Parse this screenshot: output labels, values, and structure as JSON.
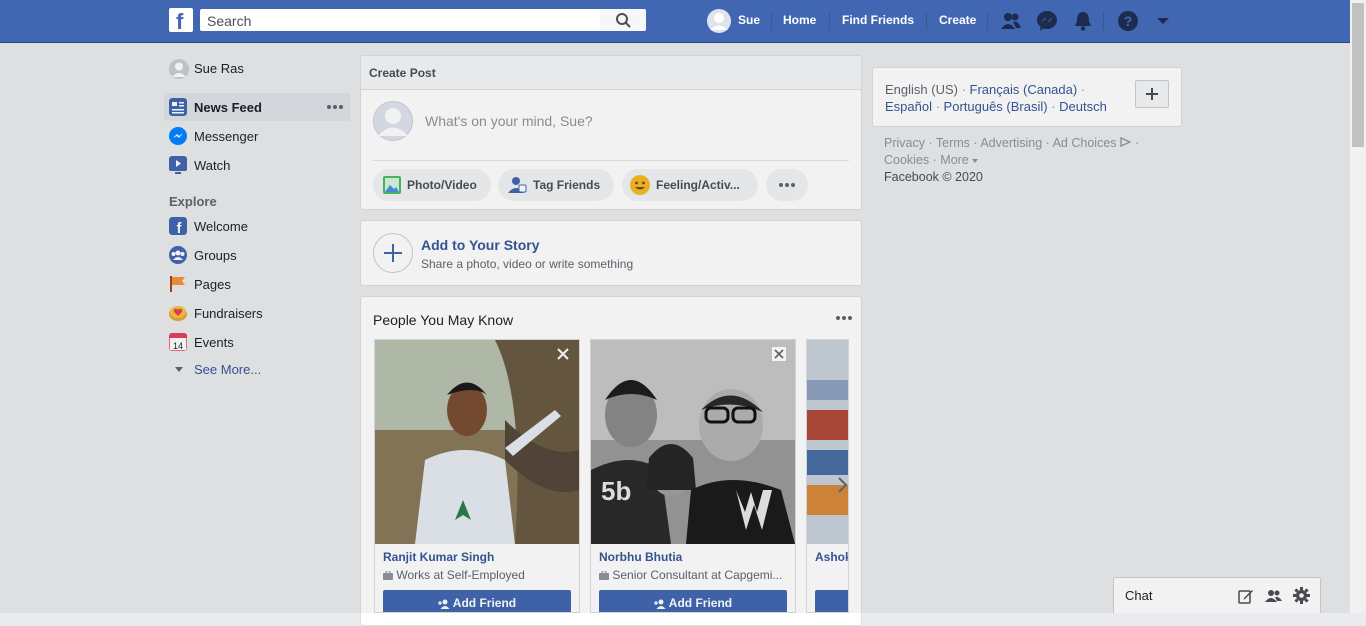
{
  "header": {
    "search_placeholder": "Search",
    "profile_name": "Sue",
    "nav": [
      "Home",
      "Find Friends",
      "Create"
    ]
  },
  "sidebar": {
    "user_name": "Sue Ras",
    "items": [
      {
        "label": "News Feed",
        "icon": "news-feed-icon"
      },
      {
        "label": "Messenger",
        "icon": "messenger-icon"
      },
      {
        "label": "Watch",
        "icon": "watch-icon"
      }
    ],
    "explore_title": "Explore",
    "explore": [
      {
        "label": "Welcome",
        "icon": "facebook-icon"
      },
      {
        "label": "Groups",
        "icon": "groups-icon"
      },
      {
        "label": "Pages",
        "icon": "flag-icon"
      },
      {
        "label": "Fundraisers",
        "icon": "fundraiser-icon"
      },
      {
        "label": "Events",
        "icon": "calendar-icon"
      }
    ],
    "see_more": "See More...",
    "calendar_day": "14"
  },
  "composer": {
    "title": "Create Post",
    "placeholder": "What's on your mind, Sue?",
    "actions": [
      "Photo/Video",
      "Tag Friends",
      "Feeling/Activ..."
    ]
  },
  "story": {
    "title": "Add to Your Story",
    "subtitle": "Share a photo, video or write something"
  },
  "pymk": {
    "title": "People You May Know",
    "people": [
      {
        "name": "Ranjit Kumar Singh",
        "work": "Works at Self-Employed",
        "button": "Add Friend"
      },
      {
        "name": "Norbhu Bhutia",
        "work": "Senior Consultant at Capgemi...",
        "button": "Add Friend"
      },
      {
        "name": "Ashok",
        "work": "",
        "button": ""
      }
    ]
  },
  "right": {
    "lang_current": "English (US)",
    "langs": [
      "Français (Canada)",
      "Español",
      "Português (Brasil)",
      "Deutsch"
    ],
    "footer_links": [
      "Privacy",
      "Terms",
      "Advertising",
      "Ad Choices",
      "Cookies",
      "More"
    ],
    "copyright": "Facebook © 2020"
  },
  "chat": {
    "label": "Chat"
  },
  "colors": {
    "brand": "#4267b2",
    "link": "#365899",
    "background": "#e9ebee"
  }
}
